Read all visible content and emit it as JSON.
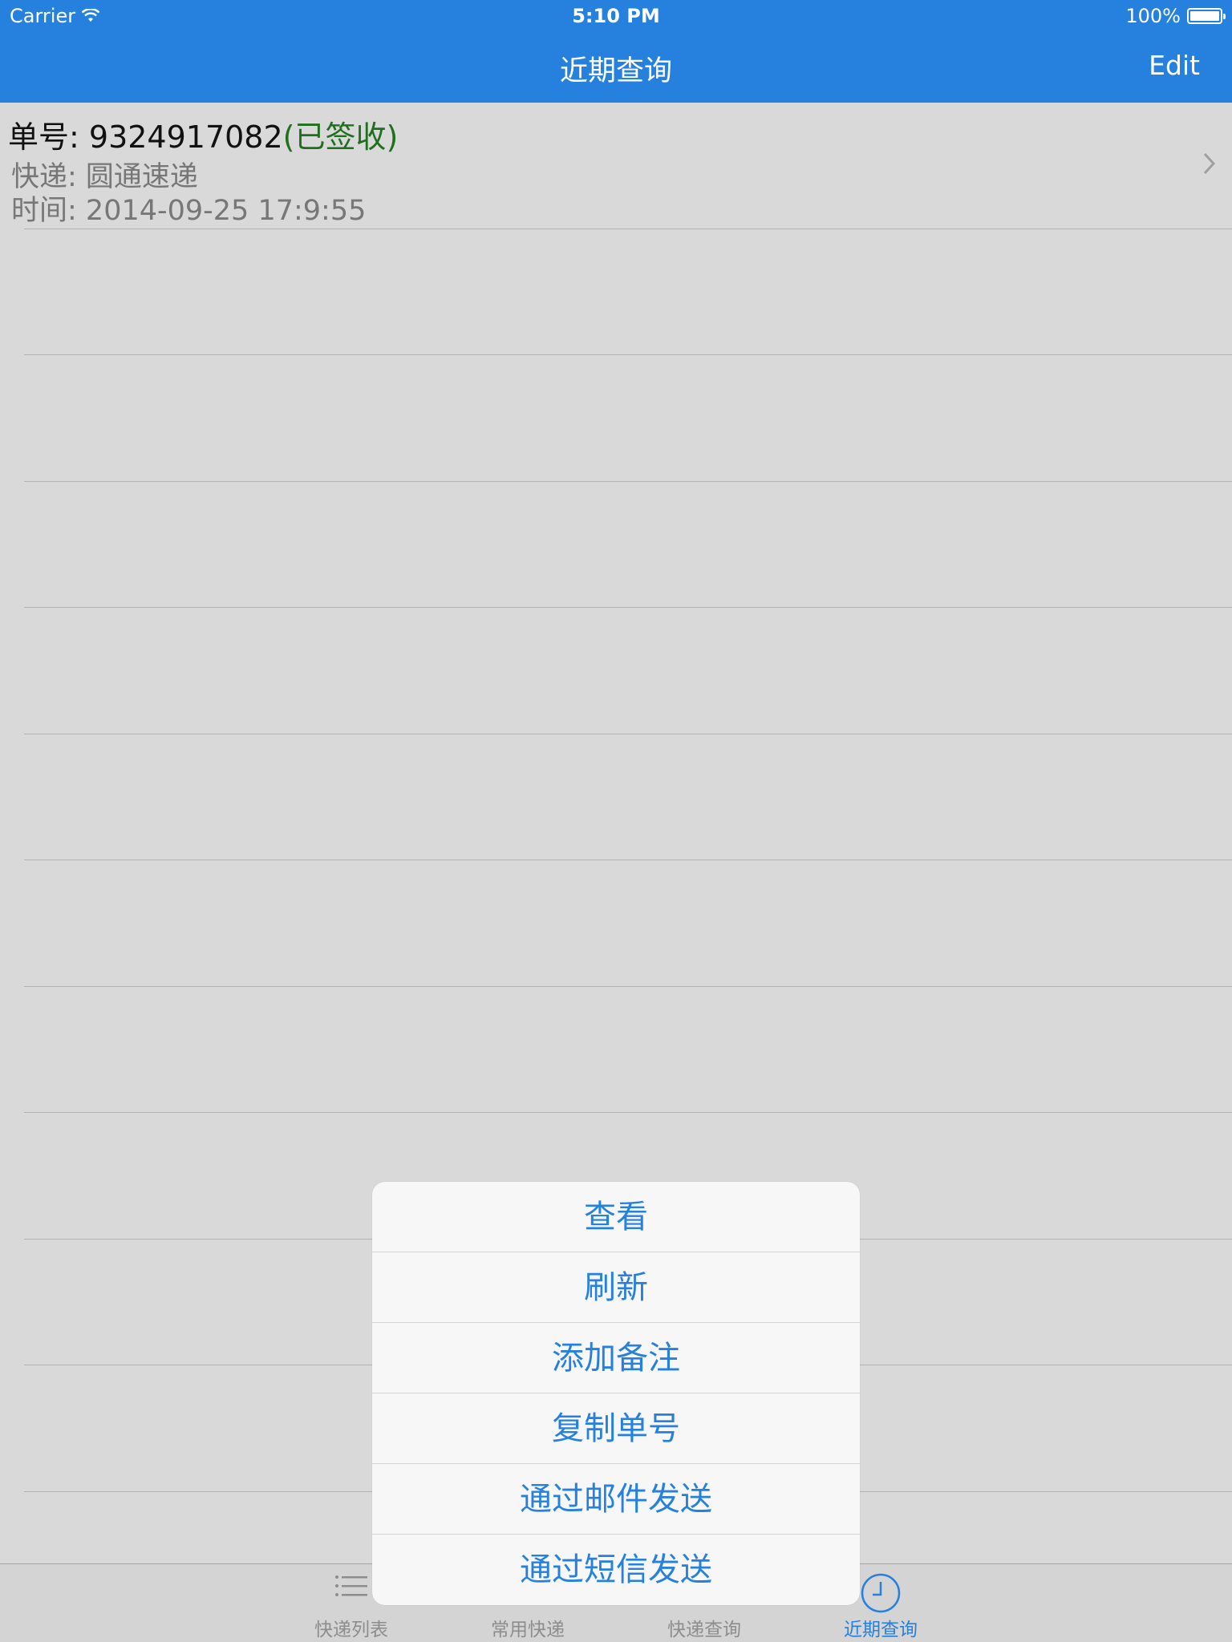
{
  "status_bar": {
    "carrier": "Carrier",
    "time": "5:10 PM",
    "battery": "100%"
  },
  "nav_bar": {
    "title": "近期查询",
    "edit_label": "Edit"
  },
  "record": {
    "number_label": "单号: ",
    "number": "9324917082",
    "status": "(已签收)",
    "courier_label": "快递: ",
    "courier": "圆通速递",
    "time_label": "时间: ",
    "time": "2014-09-25 17:9:55"
  },
  "action_sheet": {
    "items": [
      "查看",
      "刷新",
      "添加备注",
      "复制单号",
      "通过邮件发送",
      "通过短信发送"
    ]
  },
  "tab_bar": {
    "tabs": [
      {
        "label": "快递列表",
        "icon": "list-icon",
        "active": false
      },
      {
        "label": "常用快递",
        "icon": "star-icon",
        "active": false
      },
      {
        "label": "快递查询",
        "icon": "search-icon",
        "active": false
      },
      {
        "label": "近期查询",
        "icon": "clock-icon",
        "active": true
      }
    ]
  },
  "colors": {
    "accent": "#2680de",
    "signed_status": "#1f6f1f",
    "background": "#d9d9d9"
  }
}
